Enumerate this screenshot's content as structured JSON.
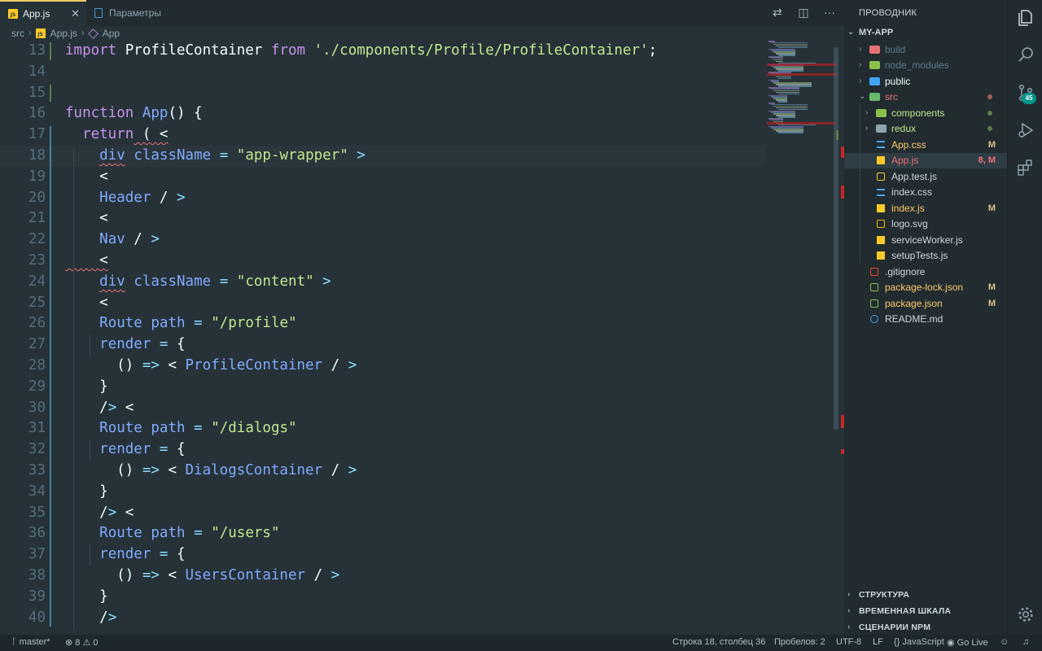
{
  "tabs": [
    {
      "icon": "js-file-icon",
      "label": "App.js",
      "active": true
    },
    {
      "icon": "settings-file-icon",
      "label": "Параметры",
      "active": false
    }
  ],
  "tab_actions": [
    "compare-changes-icon",
    "split-editor-icon",
    "more-actions-icon"
  ],
  "breadcrumb": [
    "src",
    "App.js",
    "App"
  ],
  "code_lines": [
    {
      "n": "13",
      "tokens": [
        [
          "kw",
          "import"
        ],
        [
          "tx",
          " ProfileContainer "
        ],
        [
          "kw",
          "from"
        ],
        [
          "tx",
          " "
        ],
        [
          "str",
          "'./components/Profile/ProfileContainer'"
        ],
        [
          "tx",
          ";"
        ]
      ]
    },
    {
      "n": "14",
      "tokens": []
    },
    {
      "n": "15",
      "tokens": []
    },
    {
      "n": "16",
      "tokens": [
        [
          "kw",
          "function"
        ],
        [
          "tx",
          " "
        ],
        [
          "fn",
          "App"
        ],
        [
          "tx",
          "() {"
        ]
      ]
    },
    {
      "n": "17",
      "tokens": [
        [
          "tx",
          "  "
        ],
        [
          "kw",
          "return"
        ],
        [
          "tx",
          " ( <"
        ]
      ]
    },
    {
      "n": "18",
      "tokens": [
        [
          "tx",
          "    "
        ],
        [
          "fn",
          "div"
        ],
        [
          "tx",
          " "
        ],
        [
          "fn",
          "className"
        ],
        [
          "tx",
          " "
        ],
        [
          "op",
          "="
        ],
        [
          "tx",
          " "
        ],
        [
          "str",
          "\"app-wrapper\""
        ],
        [
          "tx",
          " "
        ],
        [
          "op",
          ">"
        ]
      ]
    },
    {
      "n": "19",
      "tokens": [
        [
          "tx",
          "    <"
        ]
      ]
    },
    {
      "n": "20",
      "tokens": [
        [
          "tx",
          "    "
        ],
        [
          "fn",
          "Header"
        ],
        [
          "tx",
          " / "
        ],
        [
          "op",
          ">"
        ]
      ]
    },
    {
      "n": "21",
      "tokens": [
        [
          "tx",
          "    <"
        ]
      ]
    },
    {
      "n": "22",
      "tokens": [
        [
          "tx",
          "    "
        ],
        [
          "fn",
          "Nav"
        ],
        [
          "tx",
          " / "
        ],
        [
          "op",
          ">"
        ]
      ]
    },
    {
      "n": "23",
      "tokens": [
        [
          "tx",
          "    <"
        ]
      ]
    },
    {
      "n": "24",
      "tokens": [
        [
          "tx",
          "    "
        ],
        [
          "fn",
          "div"
        ],
        [
          "tx",
          " "
        ],
        [
          "fn",
          "className"
        ],
        [
          "tx",
          " "
        ],
        [
          "op",
          "="
        ],
        [
          "tx",
          " "
        ],
        [
          "str",
          "\"content\""
        ],
        [
          "tx",
          " "
        ],
        [
          "op",
          ">"
        ]
      ]
    },
    {
      "n": "25",
      "tokens": [
        [
          "tx",
          "    <"
        ]
      ]
    },
    {
      "n": "26",
      "tokens": [
        [
          "tx",
          "    "
        ],
        [
          "fn",
          "Route"
        ],
        [
          "tx",
          " "
        ],
        [
          "fn",
          "path"
        ],
        [
          "tx",
          " "
        ],
        [
          "op",
          "="
        ],
        [
          "tx",
          " "
        ],
        [
          "str",
          "\"/profile\""
        ]
      ]
    },
    {
      "n": "27",
      "tokens": [
        [
          "tx",
          "    "
        ],
        [
          "fn",
          "render"
        ],
        [
          "tx",
          " "
        ],
        [
          "op",
          "="
        ],
        [
          "tx",
          " {"
        ]
      ]
    },
    {
      "n": "28",
      "tokens": [
        [
          "tx",
          "      () "
        ],
        [
          "op",
          "=>"
        ],
        [
          "tx",
          " < "
        ],
        [
          "fn",
          "ProfileContainer"
        ],
        [
          "tx",
          " / "
        ],
        [
          "op",
          ">"
        ]
      ]
    },
    {
      "n": "29",
      "tokens": [
        [
          "tx",
          "    }"
        ]
      ]
    },
    {
      "n": "30",
      "tokens": [
        [
          "tx",
          "    /"
        ],
        [
          "op",
          ">"
        ],
        [
          "tx",
          " <"
        ]
      ]
    },
    {
      "n": "31",
      "tokens": [
        [
          "tx",
          "    "
        ],
        [
          "fn",
          "Route"
        ],
        [
          "tx",
          " "
        ],
        [
          "fn",
          "path"
        ],
        [
          "tx",
          " "
        ],
        [
          "op",
          "="
        ],
        [
          "tx",
          " "
        ],
        [
          "str",
          "\"/dialogs\""
        ]
      ]
    },
    {
      "n": "32",
      "tokens": [
        [
          "tx",
          "    "
        ],
        [
          "fn",
          "render"
        ],
        [
          "tx",
          " "
        ],
        [
          "op",
          "="
        ],
        [
          "tx",
          " {"
        ]
      ]
    },
    {
      "n": "33",
      "tokens": [
        [
          "tx",
          "      () "
        ],
        [
          "op",
          "=>"
        ],
        [
          "tx",
          " < "
        ],
        [
          "fn",
          "DialogsContainer"
        ],
        [
          "tx",
          " / "
        ],
        [
          "op",
          ">"
        ]
      ]
    },
    {
      "n": "34",
      "tokens": [
        [
          "tx",
          "    }"
        ]
      ]
    },
    {
      "n": "35",
      "tokens": [
        [
          "tx",
          "    /"
        ],
        [
          "op",
          ">"
        ],
        [
          "tx",
          " <"
        ]
      ]
    },
    {
      "n": "36",
      "tokens": [
        [
          "tx",
          "    "
        ],
        [
          "fn",
          "Route"
        ],
        [
          "tx",
          " "
        ],
        [
          "fn",
          "path"
        ],
        [
          "tx",
          " "
        ],
        [
          "op",
          "="
        ],
        [
          "tx",
          " "
        ],
        [
          "str",
          "\"/users\""
        ]
      ]
    },
    {
      "n": "37",
      "tokens": [
        [
          "tx",
          "    "
        ],
        [
          "fn",
          "render"
        ],
        [
          "tx",
          " "
        ],
        [
          "op",
          "="
        ],
        [
          "tx",
          " {"
        ]
      ]
    },
    {
      "n": "38",
      "tokens": [
        [
          "tx",
          "      () "
        ],
        [
          "op",
          "=>"
        ],
        [
          "tx",
          " < "
        ],
        [
          "fn",
          "UsersContainer"
        ],
        [
          "tx",
          " / "
        ],
        [
          "op",
          ">"
        ]
      ]
    },
    {
      "n": "39",
      "tokens": [
        [
          "tx",
          "    }"
        ]
      ]
    },
    {
      "n": "40",
      "tokens": [
        [
          "tx",
          "    /"
        ],
        [
          "op",
          ">"
        ]
      ]
    }
  ],
  "explorer": {
    "title": "ПРОВОДНИК",
    "project": "MY-APP",
    "items": [
      {
        "name": "build",
        "kind": "folder",
        "icon": "folder-red-icon",
        "depth": 1,
        "color": "#607d8b",
        "expanded": false
      },
      {
        "name": "node_modules",
        "kind": "folder",
        "icon": "folder-node-icon",
        "depth": 1,
        "color": "#607d8b",
        "expanded": false
      },
      {
        "name": "public",
        "kind": "folder",
        "icon": "folder-public-icon",
        "depth": 1,
        "color": "#eeffff",
        "expanded": false
      },
      {
        "name": "src",
        "kind": "folder",
        "icon": "folder-src-icon",
        "depth": 1,
        "color": "#f07178",
        "expanded": true,
        "dot": "#a25c5c"
      },
      {
        "name": "components",
        "kind": "folder",
        "icon": "folder-components-icon",
        "depth": 2,
        "color": "#c3e88d",
        "expanded": false,
        "dot": "#5d7d4a"
      },
      {
        "name": "redux",
        "kind": "folder",
        "icon": "folder-icon",
        "depth": 2,
        "color": "#c3e88d",
        "expanded": false,
        "dot": "#5d7d4a"
      },
      {
        "name": "App.css",
        "kind": "file",
        "icon": "css-file-icon",
        "depth": 2,
        "color": "#ffcb6b",
        "badge": "M"
      },
      {
        "name": "App.js",
        "kind": "file",
        "icon": "js-file-icon",
        "depth": 2,
        "color": "#f07178",
        "badge": "8, M",
        "selected": true
      },
      {
        "name": "App.test.js",
        "kind": "file",
        "icon": "test-file-icon",
        "depth": 2,
        "color": "#cfd8dc"
      },
      {
        "name": "index.css",
        "kind": "file",
        "icon": "css-file-icon",
        "depth": 2,
        "color": "#cfd8dc"
      },
      {
        "name": "index.js",
        "kind": "file",
        "icon": "js-file-icon",
        "depth": 2,
        "color": "#ffcb6b",
        "badge": "M"
      },
      {
        "name": "logo.svg",
        "kind": "file",
        "icon": "svg-file-icon",
        "depth": 2,
        "color": "#cfd8dc"
      },
      {
        "name": "serviceWorker.js",
        "kind": "file",
        "icon": "js-file-icon",
        "depth": 2,
        "color": "#cfd8dc"
      },
      {
        "name": "setupTests.js",
        "kind": "file",
        "icon": "js-file-icon",
        "depth": 2,
        "color": "#cfd8dc"
      },
      {
        "name": ".gitignore",
        "kind": "file",
        "icon": "git-file-icon",
        "depth": 1,
        "color": "#cfd8dc"
      },
      {
        "name": "package-lock.json",
        "kind": "file",
        "icon": "npm-file-icon",
        "depth": 1,
        "color": "#ffcb6b",
        "badge": "M"
      },
      {
        "name": "package.json",
        "kind": "file",
        "icon": "npm-file-icon",
        "depth": 1,
        "color": "#ffcb6b",
        "badge": "M"
      },
      {
        "name": "README.md",
        "kind": "file",
        "icon": "info-file-icon",
        "depth": 1,
        "color": "#cfd8dc"
      }
    ],
    "sections": [
      "СТРУКТУРА",
      "ВРЕМЕННАЯ ШКАЛА",
      "СЦЕНАРИИ NPM"
    ]
  },
  "activity_bar": {
    "items": [
      "explorer-icon",
      "search-icon",
      "source-control-icon",
      "run-debug-icon",
      "extensions-icon"
    ],
    "scm_count": "45",
    "bottom": "settings-gear-icon"
  },
  "status": {
    "branch": "master*",
    "errors": "8",
    "warnings": "0",
    "position": "Строка 18, столбец 36",
    "spaces": "Пробелов: 2",
    "encoding": "UTF-8",
    "eol": "LF",
    "language": "JavaScript",
    "golive": "Go Live"
  },
  "colors": {
    "background": "#263238",
    "sidebar": "#212b30",
    "accent_tab": "#ffcb6b",
    "keyword": "#c792ea",
    "function": "#82aaff",
    "string": "#c3e88d",
    "operator": "#89ddff",
    "modified": "#e2c08d"
  }
}
